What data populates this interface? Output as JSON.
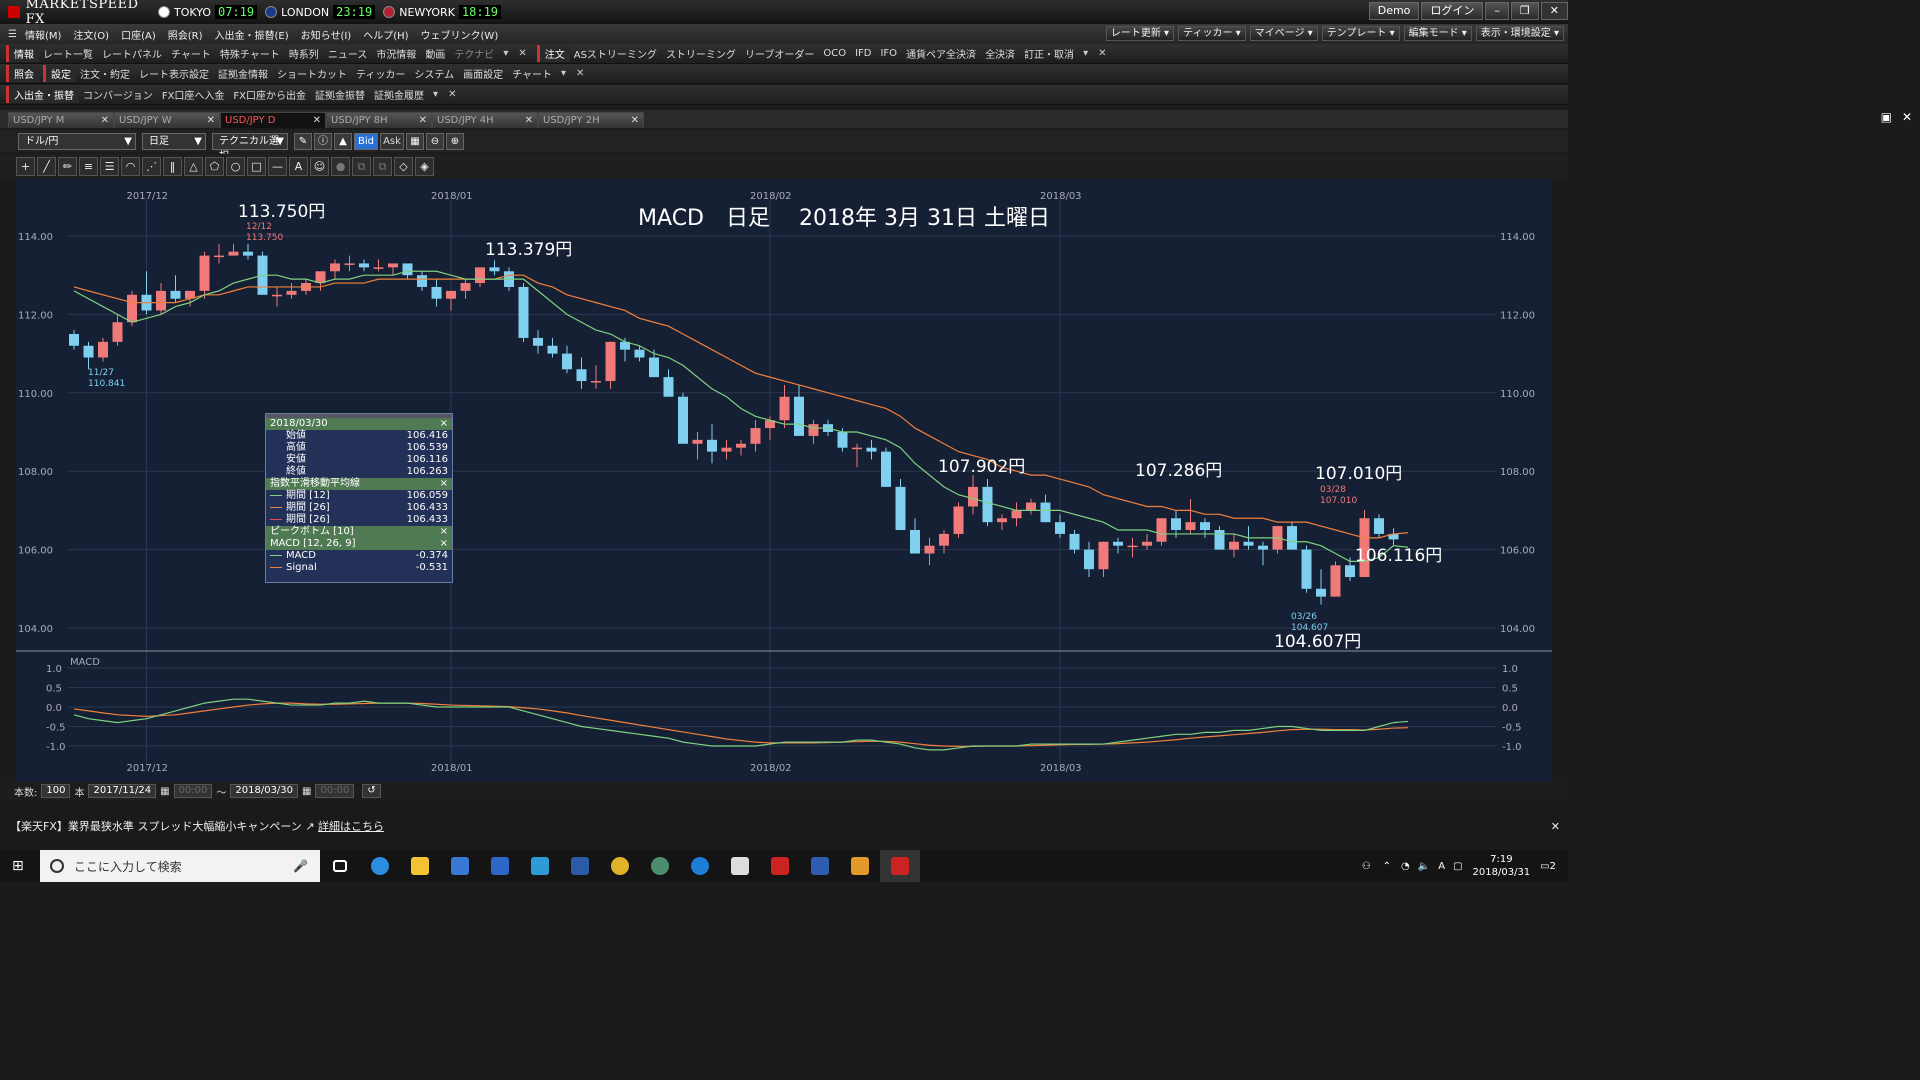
{
  "app": {
    "title": "MARKETSPEED FX"
  },
  "clocks": [
    {
      "city": "TOKYO",
      "time": "07:19",
      "flag": "#ffffff"
    },
    {
      "city": "LONDON",
      "time": "23:19",
      "flag": "#1a3a8a"
    },
    {
      "city": "NEWYORK",
      "time": "18:19",
      "flag": "#b22234"
    }
  ],
  "title_buttons": {
    "demo": "Demo",
    "login": "ログイン",
    "minimize": "–",
    "restore": "❐",
    "close": "✕"
  },
  "menu": [
    "情報(M)",
    "注文(O)",
    "口座(A)",
    "照会(R)",
    "入出金・振替(E)",
    "お知らせ(I)",
    "ヘルプ(H)",
    "ウェブリンク(W)"
  ],
  "menu_right": [
    "レート更新",
    "ティッカー",
    "マイページ",
    "テンプレート",
    "編集モード",
    "表示・環境設定"
  ],
  "toolbar1": {
    "group1": "情報",
    "items1": [
      "レート一覧",
      "レートパネル",
      "チャート",
      "特殊チャート",
      "時系列",
      "ニュース",
      "市況情報",
      "動画"
    ],
    "dim1": "テクナビ",
    "group2": "注文",
    "items2": [
      "ASストリーミング",
      "ストリーミング",
      "リーブオーダー",
      "OCO",
      "IFD",
      "IFO",
      "通貨ペア全決済",
      "全決済",
      "訂正・取消"
    ]
  },
  "toolbar2": {
    "group1": "照会",
    "group2": "設定",
    "items": [
      "注文・約定",
      "レート表示設定",
      "証拠金情報",
      "ショートカット",
      "ティッカー",
      "システム",
      "画面設定",
      "チャート"
    ]
  },
  "toolbar3": {
    "group1": "入出金・振替",
    "items": [
      "コンバージョン",
      "FX口座へ入金",
      "FX口座から出金",
      "証拠金振替",
      "証拠金履歴"
    ]
  },
  "tabs": [
    {
      "label": "USD/JPY M",
      "active": false
    },
    {
      "label": "USD/JPY W",
      "active": false
    },
    {
      "label": "USD/JPY D",
      "active": true
    },
    {
      "label": "USD/JPY 8H",
      "active": false
    },
    {
      "label": "USD/JPY 4H",
      "active": false
    },
    {
      "label": "USD/JPY 2H",
      "active": false
    }
  ],
  "controls": {
    "pair": "ドル/円",
    "period": "日足",
    "technical": "テクニカル選択",
    "bid": "Bid",
    "ask": "Ask"
  },
  "chart": {
    "title": "MACD　日足　 2018年 3月 31日 土曜日",
    "y_ticks": [
      "114.00",
      "112.00",
      "110.00",
      "108.00",
      "106.00",
      "104.00"
    ],
    "macd_ticks": [
      "1.0",
      "0.5",
      "0.0",
      "-0.5",
      "-1.0"
    ],
    "x_labels": [
      "2017/12",
      "2018/01",
      "2018/02",
      "2018/03"
    ],
    "macd_label": "MACD",
    "annotations": [
      {
        "text": "113.750円"
      },
      {
        "text": "113.379円"
      },
      {
        "text": "107.902円"
      },
      {
        "text": "107.286円"
      },
      {
        "text": "107.010円"
      },
      {
        "text": "106.116円"
      },
      {
        "text": "104.607円"
      }
    ],
    "small_labels": [
      {
        "date": "12/12",
        "value": "113.750"
      },
      {
        "date": "11/27",
        "value": "110.841"
      },
      {
        "date": "03/28",
        "value": "107.010"
      },
      {
        "date": "03/26",
        "value": "104.607"
      }
    ]
  },
  "info_panel": {
    "date": "2018/03/30",
    "rows": [
      {
        "label": "始値",
        "value": "106.416"
      },
      {
        "label": "高値",
        "value": "106.539"
      },
      {
        "label": "安値",
        "value": "106.116"
      },
      {
        "label": "終値",
        "value": "106.263"
      }
    ],
    "ema_title": "指数平滑移動平均線",
    "ema_rows": [
      {
        "label": "期間 [12]",
        "value": "106.059",
        "color": "#7fd17f"
      },
      {
        "label": "期間 [26]",
        "value": "106.433",
        "color": "#f0803c"
      },
      {
        "label": "期間 [26]",
        "value": "106.433",
        "color": "#e05050"
      }
    ],
    "peak_title": "ピークボトム [10]",
    "macd_title": "MACD [12, 26, 9]",
    "macd_rows": [
      {
        "label": "MACD",
        "value": "-0.374",
        "color": "#7fd17f"
      },
      {
        "label": "Signal",
        "value": "-0.531",
        "color": "#f0803c"
      }
    ]
  },
  "chart_data": {
    "type": "candlestick",
    "x_range": [
      "2017-11-24",
      "2018-03-30"
    ],
    "ylim": [
      103.5,
      114.7
    ],
    "ohlc": [
      [
        111.5,
        111.6,
        111.1,
        111.2
      ],
      [
        111.2,
        111.3,
        110.6,
        110.9
      ],
      [
        110.9,
        111.4,
        110.8,
        111.3
      ],
      [
        111.3,
        112.0,
        111.2,
        111.8
      ],
      [
        111.8,
        112.6,
        111.7,
        112.5
      ],
      [
        112.5,
        113.1,
        112.0,
        112.1
      ],
      [
        112.1,
        112.8,
        112.0,
        112.6
      ],
      [
        112.6,
        113.0,
        112.3,
        112.4
      ],
      [
        112.4,
        112.6,
        112.2,
        112.6
      ],
      [
        112.6,
        113.6,
        112.4,
        113.5
      ],
      [
        113.5,
        113.8,
        113.3,
        113.5
      ],
      [
        113.5,
        113.8,
        113.5,
        113.6
      ],
      [
        113.6,
        113.8,
        113.4,
        113.5
      ],
      [
        113.5,
        113.6,
        112.5,
        112.5
      ],
      [
        112.5,
        112.7,
        112.2,
        112.5
      ],
      [
        112.5,
        112.8,
        112.4,
        112.6
      ],
      [
        112.6,
        112.9,
        112.5,
        112.8
      ],
      [
        112.8,
        113.0,
        112.6,
        113.1
      ],
      [
        113.1,
        113.4,
        112.9,
        113.3
      ],
      [
        113.3,
        113.5,
        113.1,
        113.3
      ],
      [
        113.3,
        113.4,
        113.1,
        113.2
      ],
      [
        113.2,
        113.4,
        113.1,
        113.2
      ],
      [
        113.2,
        113.3,
        113.0,
        113.3
      ],
      [
        113.3,
        113.3,
        112.9,
        113.0
      ],
      [
        113.0,
        113.1,
        112.6,
        112.7
      ],
      [
        112.7,
        112.9,
        112.2,
        112.4
      ],
      [
        112.4,
        112.6,
        112.1,
        112.6
      ],
      [
        112.6,
        112.9,
        112.4,
        112.8
      ],
      [
        112.8,
        113.2,
        112.7,
        113.2
      ],
      [
        113.2,
        113.38,
        113.0,
        113.1
      ],
      [
        113.1,
        113.2,
        112.6,
        112.7
      ],
      [
        112.7,
        112.8,
        111.3,
        111.4
      ],
      [
        111.4,
        111.6,
        111.0,
        111.2
      ],
      [
        111.2,
        111.4,
        110.9,
        111.0
      ],
      [
        111.0,
        111.2,
        110.5,
        110.6
      ],
      [
        110.6,
        110.9,
        110.1,
        110.3
      ],
      [
        110.3,
        110.7,
        110.1,
        110.3
      ],
      [
        110.3,
        111.3,
        110.1,
        111.3
      ],
      [
        111.3,
        111.4,
        110.8,
        111.1
      ],
      [
        111.1,
        111.2,
        110.8,
        110.9
      ],
      [
        110.9,
        111.1,
        110.4,
        110.4
      ],
      [
        110.4,
        110.6,
        109.9,
        109.9
      ],
      [
        109.9,
        110.0,
        108.7,
        108.7
      ],
      [
        108.7,
        109.0,
        108.3,
        108.8
      ],
      [
        108.8,
        109.2,
        108.2,
        108.5
      ],
      [
        108.5,
        108.8,
        108.3,
        108.6
      ],
      [
        108.6,
        108.8,
        108.4,
        108.7
      ],
      [
        108.7,
        109.3,
        108.5,
        109.1
      ],
      [
        109.1,
        109.4,
        108.8,
        109.3
      ],
      [
        109.3,
        110.2,
        109.1,
        109.9
      ],
      [
        109.9,
        110.2,
        108.9,
        108.9
      ],
      [
        108.9,
        109.3,
        108.7,
        109.2
      ],
      [
        109.2,
        109.3,
        108.9,
        109.0
      ],
      [
        109.0,
        109.1,
        108.5,
        108.6
      ],
      [
        108.6,
        108.7,
        108.1,
        108.6
      ],
      [
        108.6,
        108.8,
        108.3,
        108.5
      ],
      [
        108.5,
        108.6,
        107.6,
        107.6
      ],
      [
        107.6,
        107.8,
        106.5,
        106.5
      ],
      [
        106.5,
        106.8,
        105.9,
        105.9
      ],
      [
        105.9,
        106.3,
        105.6,
        106.1
      ],
      [
        106.1,
        106.5,
        105.9,
        106.4
      ],
      [
        106.4,
        107.2,
        106.3,
        107.1
      ],
      [
        107.1,
        107.9,
        106.9,
        107.6
      ],
      [
        107.6,
        107.8,
        106.6,
        106.7
      ],
      [
        106.7,
        106.9,
        106.5,
        106.8
      ],
      [
        106.8,
        107.2,
        106.6,
        107.0
      ],
      [
        107.0,
        107.3,
        106.9,
        107.2
      ],
      [
        107.2,
        107.4,
        106.7,
        106.7
      ],
      [
        106.7,
        106.9,
        106.3,
        106.4
      ],
      [
        106.4,
        106.5,
        105.9,
        106.0
      ],
      [
        106.0,
        106.2,
        105.3,
        105.5
      ],
      [
        105.5,
        106.2,
        105.3,
        106.2
      ],
      [
        106.2,
        106.3,
        105.9,
        106.1
      ],
      [
        106.1,
        106.3,
        105.8,
        106.1
      ],
      [
        106.1,
        106.4,
        106.0,
        106.2
      ],
      [
        106.2,
        106.8,
        106.1,
        106.8
      ],
      [
        106.8,
        107.0,
        106.3,
        106.5
      ],
      [
        106.5,
        107.29,
        106.4,
        106.7
      ],
      [
        106.7,
        106.8,
        106.3,
        106.5
      ],
      [
        106.5,
        106.6,
        106.0,
        106.0
      ],
      [
        106.0,
        106.4,
        105.8,
        106.2
      ],
      [
        106.2,
        106.6,
        106.0,
        106.1
      ],
      [
        106.1,
        106.2,
        105.6,
        106.0
      ],
      [
        106.0,
        106.6,
        105.9,
        106.6
      ],
      [
        106.6,
        106.7,
        106.0,
        106.0
      ],
      [
        106.0,
        106.1,
        104.9,
        105.0
      ],
      [
        105.0,
        105.5,
        104.6,
        104.8
      ],
      [
        104.8,
        105.7,
        104.8,
        105.6
      ],
      [
        105.6,
        105.8,
        105.2,
        105.3
      ],
      [
        105.3,
        107.01,
        105.3,
        106.8
      ],
      [
        106.8,
        106.9,
        106.3,
        106.4
      ],
      [
        106.4,
        106.54,
        106.12,
        106.26
      ]
    ],
    "ema12": [
      112.6,
      112.4,
      112.2,
      112.0,
      111.8,
      111.9,
      112.0,
      112.2,
      112.3,
      112.5,
      112.6,
      112.8,
      112.9,
      113.0,
      113.0,
      112.9,
      112.9,
      112.8,
      112.9,
      112.9,
      113.0,
      113.0,
      113.0,
      113.1,
      113.1,
      113.1,
      113.0,
      112.9,
      112.9,
      112.9,
      112.9,
      112.9,
      112.6,
      112.3,
      112.0,
      111.8,
      111.6,
      111.5,
      111.3,
      111.2,
      111.0,
      110.9,
      110.7,
      110.4,
      110.1,
      109.9,
      109.6,
      109.4,
      109.3,
      109.2,
      109.2,
      109.1,
      109.1,
      109.0,
      109.0,
      108.9,
      108.8,
      108.6,
      108.2,
      107.9,
      107.6,
      107.4,
      107.3,
      107.2,
      107.1,
      107.0,
      107.0,
      107.0,
      107.0,
      106.9,
      106.8,
      106.7,
      106.5,
      106.5,
      106.5,
      106.4,
      106.4,
      106.4,
      106.4,
      106.4,
      106.4,
      106.3,
      106.3,
      106.3,
      106.2,
      106.2,
      106.1,
      105.9,
      105.7,
      105.7,
      105.8,
      106.1,
      106.06
    ],
    "ema26": [
      112.7,
      112.6,
      112.5,
      112.4,
      112.3,
      112.3,
      112.3,
      112.3,
      112.4,
      112.5,
      112.5,
      112.6,
      112.7,
      112.7,
      112.7,
      112.7,
      112.7,
      112.7,
      112.8,
      112.8,
      112.8,
      112.9,
      112.9,
      112.9,
      112.9,
      112.9,
      112.9,
      112.9,
      112.9,
      112.9,
      113.0,
      113.0,
      112.8,
      112.7,
      112.5,
      112.4,
      112.3,
      112.2,
      112.1,
      111.9,
      111.8,
      111.7,
      111.5,
      111.3,
      111.1,
      110.9,
      110.7,
      110.5,
      110.4,
      110.3,
      110.2,
      110.1,
      110.0,
      109.9,
      109.8,
      109.7,
      109.6,
      109.4,
      109.1,
      108.9,
      108.7,
      108.5,
      108.4,
      108.3,
      108.1,
      108.0,
      107.9,
      107.9,
      107.8,
      107.7,
      107.6,
      107.4,
      107.3,
      107.2,
      107.1,
      107.1,
      107.0,
      107.0,
      106.9,
      106.9,
      106.8,
      106.8,
      106.8,
      106.7,
      106.7,
      106.7,
      106.6,
      106.5,
      106.4,
      106.3,
      106.3,
      106.4,
      106.43
    ],
    "macd": [
      -0.2,
      -0.3,
      -0.35,
      -0.4,
      -0.35,
      -0.3,
      -0.2,
      -0.1,
      0.0,
      0.1,
      0.15,
      0.2,
      0.2,
      0.15,
      0.1,
      0.05,
      0.05,
      0.05,
      0.1,
      0.1,
      0.15,
      0.1,
      0.1,
      0.1,
      0.05,
      0.0,
      0.0,
      0.0,
      0.0,
      0.0,
      0.0,
      -0.1,
      -0.2,
      -0.3,
      -0.4,
      -0.5,
      -0.55,
      -0.6,
      -0.65,
      -0.7,
      -0.75,
      -0.8,
      -0.9,
      -0.95,
      -1.0,
      -1.0,
      -1.0,
      -1.0,
      -0.95,
      -0.9,
      -0.9,
      -0.9,
      -0.9,
      -0.9,
      -0.85,
      -0.85,
      -0.9,
      -0.95,
      -1.05,
      -1.1,
      -1.1,
      -1.05,
      -1.0,
      -1.0,
      -1.0,
      -1.0,
      -0.95,
      -0.95,
      -0.95,
      -0.95,
      -0.95,
      -0.95,
      -0.9,
      -0.85,
      -0.8,
      -0.75,
      -0.7,
      -0.7,
      -0.65,
      -0.65,
      -0.6,
      -0.6,
      -0.55,
      -0.5,
      -0.5,
      -0.55,
      -0.6,
      -0.6,
      -0.6,
      -0.6,
      -0.5,
      -0.4,
      -0.37
    ],
    "signal": [
      -0.05,
      -0.1,
      -0.15,
      -0.2,
      -0.22,
      -0.24,
      -0.22,
      -0.2,
      -0.15,
      -0.1,
      -0.05,
      0.0,
      0.05,
      0.08,
      0.1,
      0.1,
      0.08,
      0.07,
      0.07,
      0.08,
      0.09,
      0.1,
      0.1,
      0.1,
      0.09,
      0.07,
      0.05,
      0.04,
      0.03,
      0.02,
      0.01,
      -0.02,
      -0.05,
      -0.1,
      -0.15,
      -0.22,
      -0.28,
      -0.34,
      -0.4,
      -0.46,
      -0.52,
      -0.58,
      -0.64,
      -0.7,
      -0.76,
      -0.82,
      -0.86,
      -0.9,
      -0.92,
      -0.92,
      -0.92,
      -0.92,
      -0.91,
      -0.9,
      -0.89,
      -0.88,
      -0.88,
      -0.9,
      -0.94,
      -0.98,
      -1.0,
      -1.01,
      -1.01,
      -1.0,
      -1.0,
      -1.0,
      -0.99,
      -0.98,
      -0.97,
      -0.96,
      -0.96,
      -0.95,
      -0.94,
      -0.92,
      -0.9,
      -0.87,
      -0.84,
      -0.8,
      -0.77,
      -0.74,
      -0.71,
      -0.68,
      -0.65,
      -0.61,
      -0.58,
      -0.57,
      -0.57,
      -0.58,
      -0.58,
      -0.59,
      -0.57,
      -0.54,
      -0.53
    ]
  },
  "bottom": {
    "count_label": "本数:",
    "count": "100",
    "unit": "本",
    "start": "2017/11/24",
    "time1": "00:00",
    "tilde": "〜",
    "end": "2018/03/30",
    "time2": "00:00"
  },
  "promo": {
    "text": "【楽天FX】業界最狭水準 スプレッド大幅縮小キャンペーン",
    "link": "詳細はこちら"
  },
  "taskbar": {
    "search_placeholder": "ここに入力して検索",
    "time": "7:19",
    "date": "2018/03/31",
    "notif": "2"
  }
}
